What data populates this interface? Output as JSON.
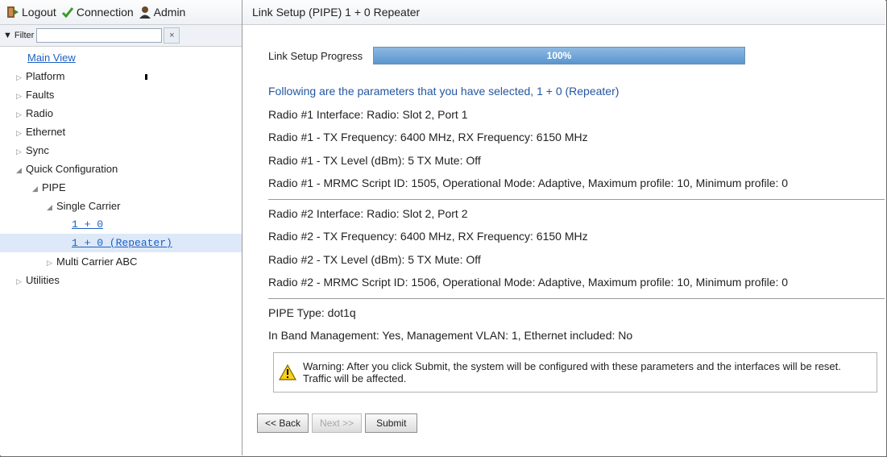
{
  "topbar": {
    "logout": "Logout",
    "connection": "Connection",
    "admin": "Admin"
  },
  "filter": {
    "label": "Filter",
    "value": "",
    "clear": "×"
  },
  "tree": {
    "main_view": "Main View",
    "platform": "Platform",
    "faults": "Faults",
    "radio": "Radio",
    "ethernet": "Ethernet",
    "sync": "Sync",
    "quick_config": "Quick Configuration",
    "pipe": "PIPE",
    "single_carrier": "Single Carrier",
    "one_plus_zero": "1 + 0",
    "one_plus_zero_repeater": "1 + 0 (Repeater)",
    "multi_carrier": "Multi Carrier ABC",
    "utilities": "Utilities"
  },
  "page": {
    "title": "Link Setup (PIPE) 1 + 0 Repeater"
  },
  "progress": {
    "label": "Link Setup Progress",
    "value": 100,
    "text": "100%"
  },
  "summary": {
    "heading": "Following are the parameters that you have selected, 1 + 0 (Repeater)",
    "radio1_interface": "Radio #1 Interface: Radio: Slot 2, Port 1",
    "radio1_freq": "Radio #1 - TX Frequency: 6400 MHz, RX Frequency: 6150 MHz",
    "radio1_level": "Radio #1 - TX Level (dBm): 5 TX Mute: Off",
    "radio1_mrmc": "Radio #1 - MRMC Script ID: 1505, Operational Mode: Adaptive, Maximum profile: 10, Minimum profile: 0",
    "radio2_interface": "Radio #2 Interface: Radio: Slot 2, Port 2",
    "radio2_freq": "Radio #2 - TX Frequency: 6400 MHz, RX Frequency: 6150 MHz",
    "radio2_level": "Radio #2 - TX Level (dBm): 5 TX Mute: Off",
    "radio2_mrmc": "Radio #2 - MRMC Script ID: 1506, Operational Mode: Adaptive, Maximum profile: 10, Minimum profile: 0",
    "pipe_type": "PIPE Type: dot1q",
    "inband": "In Band Management: Yes, Management VLAN: 1, Ethernet included: No"
  },
  "warning": {
    "line1": "Warning: After you click Submit, the system will be configured with these parameters and the interfaces will be reset.",
    "line2": "Traffic will be affected."
  },
  "buttons": {
    "back": "<< Back",
    "next": "Next >>",
    "submit": "Submit"
  },
  "colors": {
    "accent": "#2456a0",
    "link": "#1d5fc4",
    "progress": "#5b95cf",
    "selected": "#dde9f8"
  }
}
